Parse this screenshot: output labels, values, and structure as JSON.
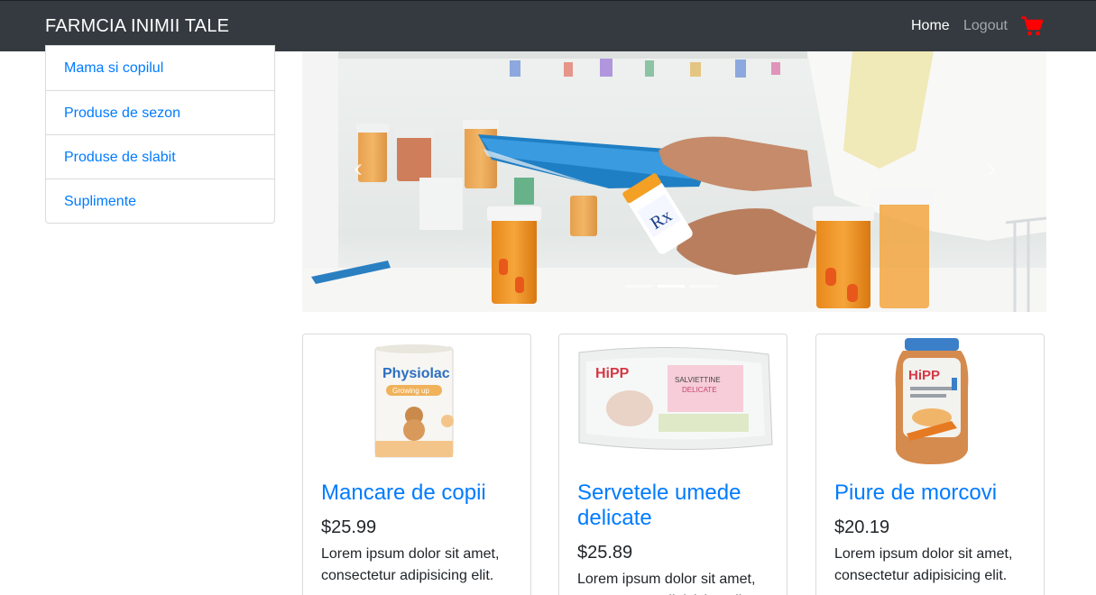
{
  "navbar": {
    "brand": "FARMCIA INIMII TALE",
    "home_label": "Home",
    "logout_label": "Logout",
    "cart_icon": "shopping-cart-icon",
    "cart_color": "#ff0000"
  },
  "sidebar": {
    "items": [
      {
        "label": "Mama si copilul"
      },
      {
        "label": "Produse de sezon"
      },
      {
        "label": "Produse de slabit"
      },
      {
        "label": "Suplimente"
      }
    ]
  },
  "carousel": {
    "prev_icon": "chevron-left-icon",
    "next_icon": "chevron-right-icon",
    "prev_glyph": "‹",
    "next_glyph": "›",
    "slides": 3,
    "active_slide": 2
  },
  "products": [
    {
      "title": "Mancare de copii",
      "price": "$25.99",
      "description": "Lorem ipsum dolor sit amet, consectetur adipisicing elit."
    },
    {
      "title": "Servetele umede delicate",
      "price": "$25.89",
      "description": "Lorem ipsum dolor sit amet, consectetur adipisicing elit."
    },
    {
      "title": "Piure de morcovi",
      "price": "$20.19",
      "description": "Lorem ipsum dolor sit amet, consectetur adipisicing elit."
    }
  ],
  "colors": {
    "navbar_bg": "#343a40",
    "link": "#007bff",
    "cart": "#ff0000"
  }
}
